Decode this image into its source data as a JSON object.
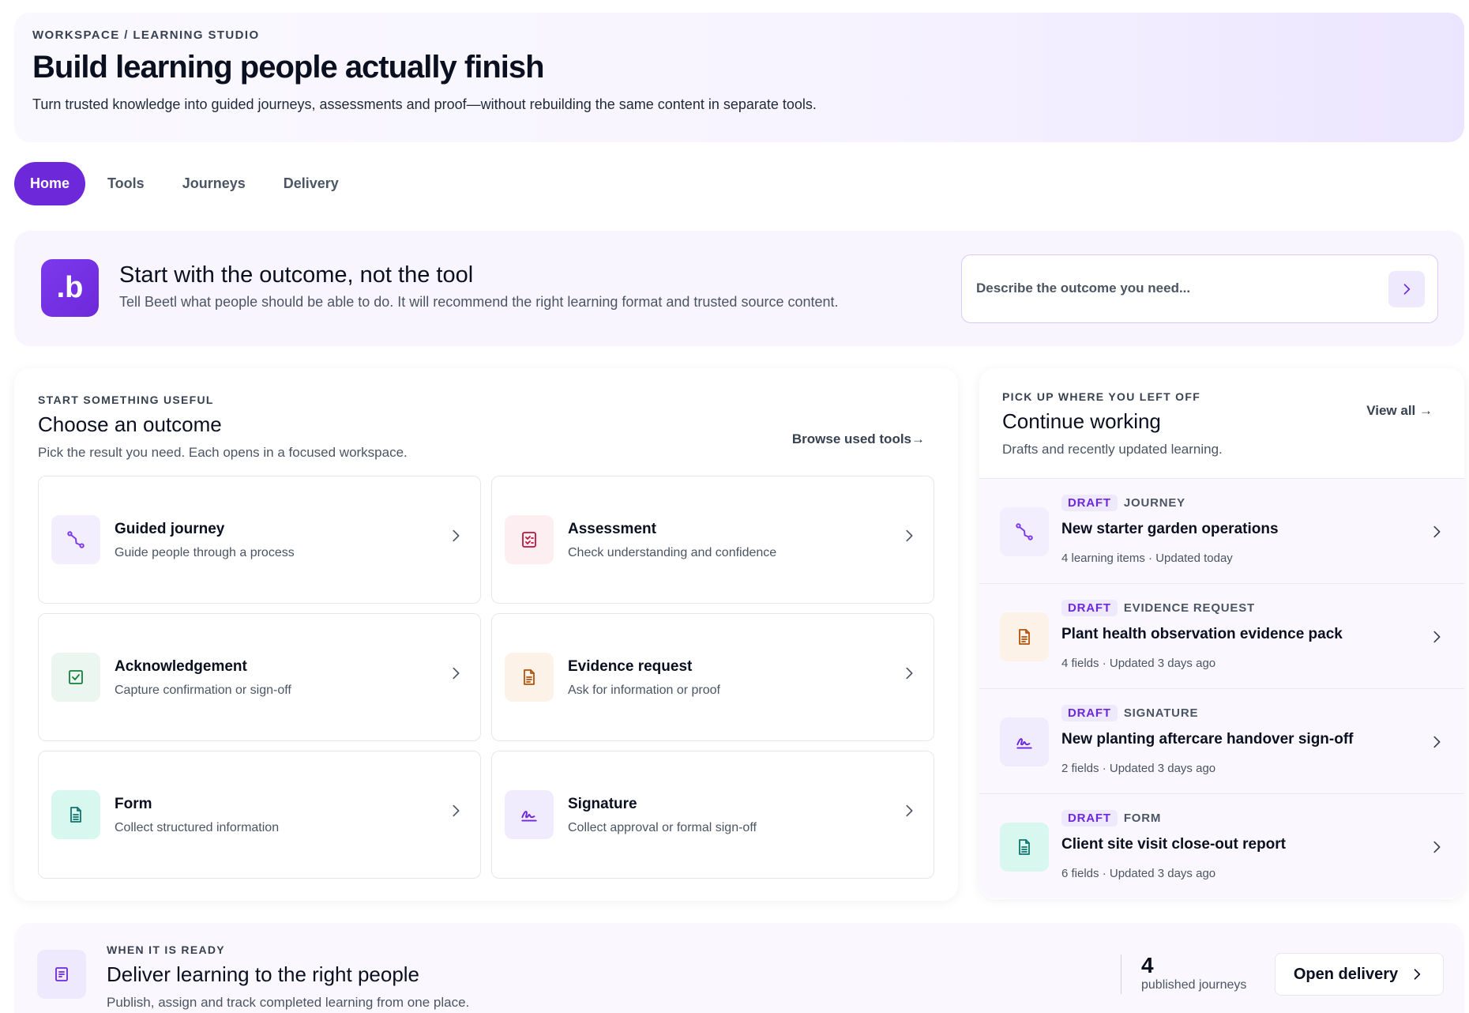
{
  "header": {
    "breadcrumb": "WORKSPACE / LEARNING STUDIO",
    "title": "Build learning people actually finish",
    "subtitle": "Turn trusted knowledge into guided journeys, assessments and proof—without rebuilding the same content in separate tools."
  },
  "tabs": [
    {
      "label": "Home",
      "active": true
    },
    {
      "label": "Tools",
      "active": false
    },
    {
      "label": "Journeys",
      "active": false
    },
    {
      "label": "Delivery",
      "active": false
    }
  ],
  "banner": {
    "logo_text": ".b",
    "title": "Start with the outcome, not the tool",
    "subtitle": "Tell Beetl what people should be able to do. It will recommend the right learning format and trusted source content.",
    "input_placeholder": "Describe the outcome you need...",
    "input_value": ""
  },
  "outcomes": {
    "eyebrow": "START SOMETHING USEFUL",
    "title": "Choose an outcome",
    "subtitle": "Pick the result you need. Each opens in a focused workspace.",
    "browse_link": "Browse used tools→",
    "items": [
      {
        "name": "Guided journey",
        "desc": "Guide people through a process",
        "icon": "route-icon"
      },
      {
        "name": "Assessment",
        "desc": "Check understanding and confidence",
        "icon": "checklist-icon"
      },
      {
        "name": "Acknowledgement",
        "desc": "Capture confirmation or sign-off",
        "icon": "check-square-icon"
      },
      {
        "name": "Evidence request",
        "desc": "Ask for information or proof",
        "icon": "document-icon"
      },
      {
        "name": "Form",
        "desc": "Collect structured information",
        "icon": "form-icon"
      },
      {
        "name": "Signature",
        "desc": "Collect approval or formal sign-off",
        "icon": "signature-icon"
      }
    ]
  },
  "continue": {
    "eyebrow": "PICK UP WHERE YOU LEFT OFF",
    "title": "Continue working",
    "subtitle": "Drafts and recently updated learning.",
    "view_all": "View all →",
    "items": [
      {
        "status": "DRAFT",
        "type": "JOURNEY",
        "title": "New starter garden operations",
        "meta": "4 learning items · Updated today",
        "icon": "route-icon"
      },
      {
        "status": "DRAFT",
        "type": "EVIDENCE REQUEST",
        "title": "Plant health observation evidence pack",
        "meta": "4 fields · Updated 3 days ago",
        "icon": "document-icon"
      },
      {
        "status": "DRAFT",
        "type": "SIGNATURE",
        "title": "New planting aftercare handover sign-off",
        "meta": "2 fields · Updated 3 days ago",
        "icon": "signature-icon"
      },
      {
        "status": "DRAFT",
        "type": "FORM",
        "title": "Client site visit close-out report",
        "meta": "6 fields · Updated 3 days ago",
        "icon": "form-icon"
      }
    ]
  },
  "delivery": {
    "eyebrow": "WHEN IT IS READY",
    "title": "Deliver learning to the right people",
    "subtitle": "Publish, assign and track completed learning from one place.",
    "stat_value": "4",
    "stat_label": "published journeys",
    "button_label": "Open delivery"
  },
  "colors": {
    "accent": "#6d28d9",
    "purple_tile": "#f3eefe",
    "red_tile": "#fdeff1",
    "green_tile": "#eaf6ef",
    "amber_tile": "#fdf2e7",
    "teal_tile": "#d8f7ef",
    "violet_tile": "#f1ecfd"
  }
}
